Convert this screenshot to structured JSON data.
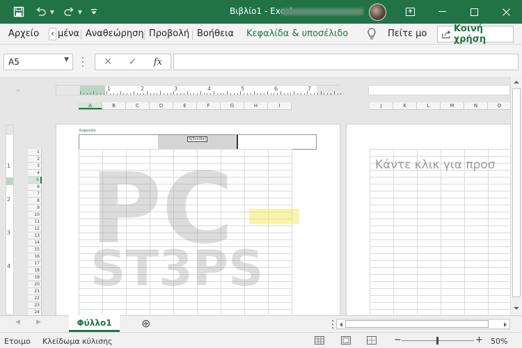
{
  "title_bar": {
    "doc_title": "Βιβλίο1",
    "separator": "-",
    "app_name": "Excel",
    "qat": {
      "save_icon": "save-icon",
      "undo_icon": "undo-icon",
      "redo_icon": "redo-icon",
      "customize_icon": "customize-qat-icon"
    },
    "window_controls": [
      "ribbon-display-icon",
      "minimize-icon",
      "maximize-icon",
      "close-icon"
    ]
  },
  "ribbon": {
    "tabs": {
      "file": "Αρχείο",
      "scroll_left": "‹",
      "partial": "μένα",
      "review": "Αναθεώρηση",
      "view": "Προβολή",
      "help": "Βοήθεια",
      "header_footer": "Κεφαλίδα & υποσέλιδο"
    },
    "tell_me": "Πείτε μο",
    "share": "Κοινή χρήση"
  },
  "formula_bar": {
    "name_box": "A5",
    "cancel_symbol": "✕",
    "enter_symbol": "✓",
    "fx_symbol": "fx",
    "formula": ""
  },
  "ruler_numbers": [
    "1",
    "2",
    "3",
    "4",
    "5",
    "6",
    "7"
  ],
  "vruler_numbers": [
    "1",
    "2",
    "3",
    "4"
  ],
  "columns_page1": [
    "A",
    "B",
    "C",
    "D",
    "E",
    "F",
    "G",
    "H",
    "I"
  ],
  "columns_page2": [
    "J",
    "K",
    "L",
    "M",
    "N",
    "O"
  ],
  "rows": [
    "1",
    "2",
    "3",
    "4",
    "5",
    "6",
    "7",
    "8",
    "9",
    "10",
    "11",
    "12",
    "13",
    "14",
    "15",
    "16",
    "17",
    "18",
    "19",
    "20",
    "21",
    "22",
    "23",
    "24"
  ],
  "active_row": "5",
  "active_col": "A",
  "header_area": {
    "label": "Κεφαλίδα",
    "center_field": "&[Σελίδα]"
  },
  "page2_placeholder": "Κάντε κλικ για προσ",
  "watermark": {
    "line1": "PC",
    "line2": "ST3PS"
  },
  "sheet_tabs": [
    {
      "label": "Φύλλο1",
      "active": true
    }
  ],
  "add_sheet_symbol": "⊕",
  "status_bar": {
    "ready": "Ετοιμο",
    "scroll_lock": "Κλείδωμα κύλισης",
    "zoom_minus": "−",
    "zoom_plus": "+",
    "zoom_level": "50%"
  },
  "colors": {
    "accent": "#217346",
    "background": "#e6e6e6",
    "ribbon": "#f3f3f3"
  }
}
